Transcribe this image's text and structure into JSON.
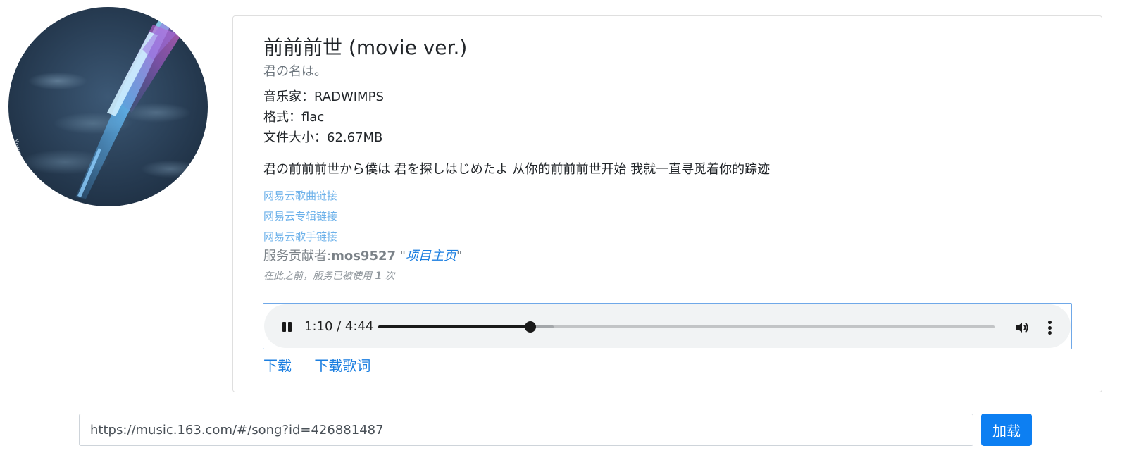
{
  "cover": {
    "caption": "Your N"
  },
  "song": {
    "title": "前前前世 (movie ver.)",
    "album": "君の名は。",
    "artist_line": "音乐家：RADWIMPS",
    "format_line": "格式：flac",
    "size_line": "文件大小：62.67MB",
    "lyric": "君の前前前世から僕は 君を探しはじめたよ 从你的前前前世开始 我就一直寻觅着你的踪迹"
  },
  "links": {
    "song": "网易云歌曲链接",
    "album": "网易云专辑链接",
    "artist": "网易云歌手链接"
  },
  "contributor": {
    "prefix": "服务贡献者:",
    "name": "mos9527",
    "quote_open": " \"",
    "project_link": "项目主页",
    "quote_close": "\""
  },
  "usage": {
    "prefix": "在此之前，服务已被使用 ",
    "count": "1",
    "suffix": " 次"
  },
  "player": {
    "time": "1:10 / 4:44",
    "progress_fraction": 0.2465,
    "buffered_fraction": 0.284,
    "pause_icon": "pause-icon",
    "volume_icon": "volume-icon",
    "more_icon": "more-vertical-icon"
  },
  "downloads": {
    "download": "下载",
    "download_lyrics": "下载歌词"
  },
  "loader": {
    "url_value": "https://music.163.com/#/song?id=426881487",
    "button": "加载"
  },
  "colors": {
    "accent": "#0d7ff2",
    "link_light": "#6cb1ea",
    "muted": "#6c757d"
  }
}
